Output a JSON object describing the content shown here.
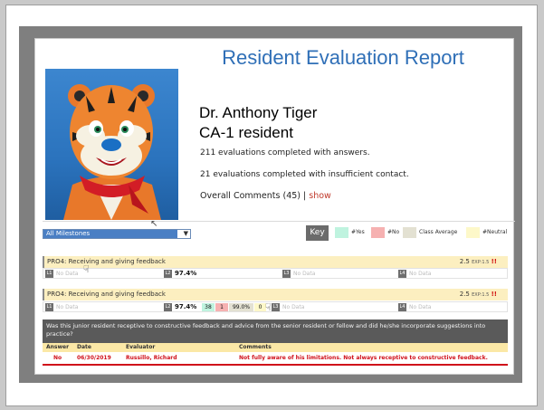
{
  "report": {
    "title": "Resident Evaluation Report",
    "name": "Dr. Anthony Tiger",
    "role": "CA-1 resident",
    "evaluations_with_answers": "211 evaluations completed with answers.",
    "evaluations_insufficient": "21 evaluations completed with insufficient contact.",
    "overall_comments_label": "Overall Comments (45)",
    "separator": "|",
    "show_link": "show"
  },
  "filter": {
    "selected": "All Milestones",
    "key_label": "Key"
  },
  "legend": [
    {
      "label": "#Yes",
      "color": "#bff3df"
    },
    {
      "label": "#No",
      "color": "#f6b1b1"
    },
    {
      "label": "Class Average",
      "color": "#e3e1d2"
    },
    {
      "label": "#Neutral",
      "color": "#fdf8c9"
    }
  ],
  "milestone_rows": [
    {
      "title": "PRO4: Receiving and giving feedback",
      "score": "2.5",
      "expected": "EXP:1.5",
      "flag": "!!",
      "levels": {
        "l1": "No Data",
        "l2": "97.4%",
        "l3": "No Data",
        "l4": "No Data"
      }
    },
    {
      "title": "PRO4: Receiving and giving feedback",
      "score": "2.5",
      "expected": "EXP:1.5",
      "flag": "!!",
      "levels": {
        "l1": "No Data",
        "l2": "97.4%",
        "l3": "No Data",
        "l4": "No Data"
      },
      "breakdown": {
        "yes": "38",
        "no": "1",
        "class_average": "99.0%",
        "neutral": "0"
      }
    }
  ],
  "level_labels": {
    "l1": "L1",
    "l2": "L2",
    "l3": "L3",
    "l4": "L4"
  },
  "question": "Was this junior resident receptive to constructive feedback and advice from the senior resident or fellow and did he/she incorporate suggestions into practice?",
  "evaluation_table": {
    "headers": {
      "answer": "Answer",
      "date": "Date",
      "evaluator": "Evaluator",
      "comments": "Comments"
    },
    "rows": [
      {
        "answer": "No",
        "date": "06/30/2019",
        "evaluator": "Russillo, Richard",
        "comments": "Not fully aware of his limitations. Not always receptive to constructive feedback."
      }
    ]
  }
}
